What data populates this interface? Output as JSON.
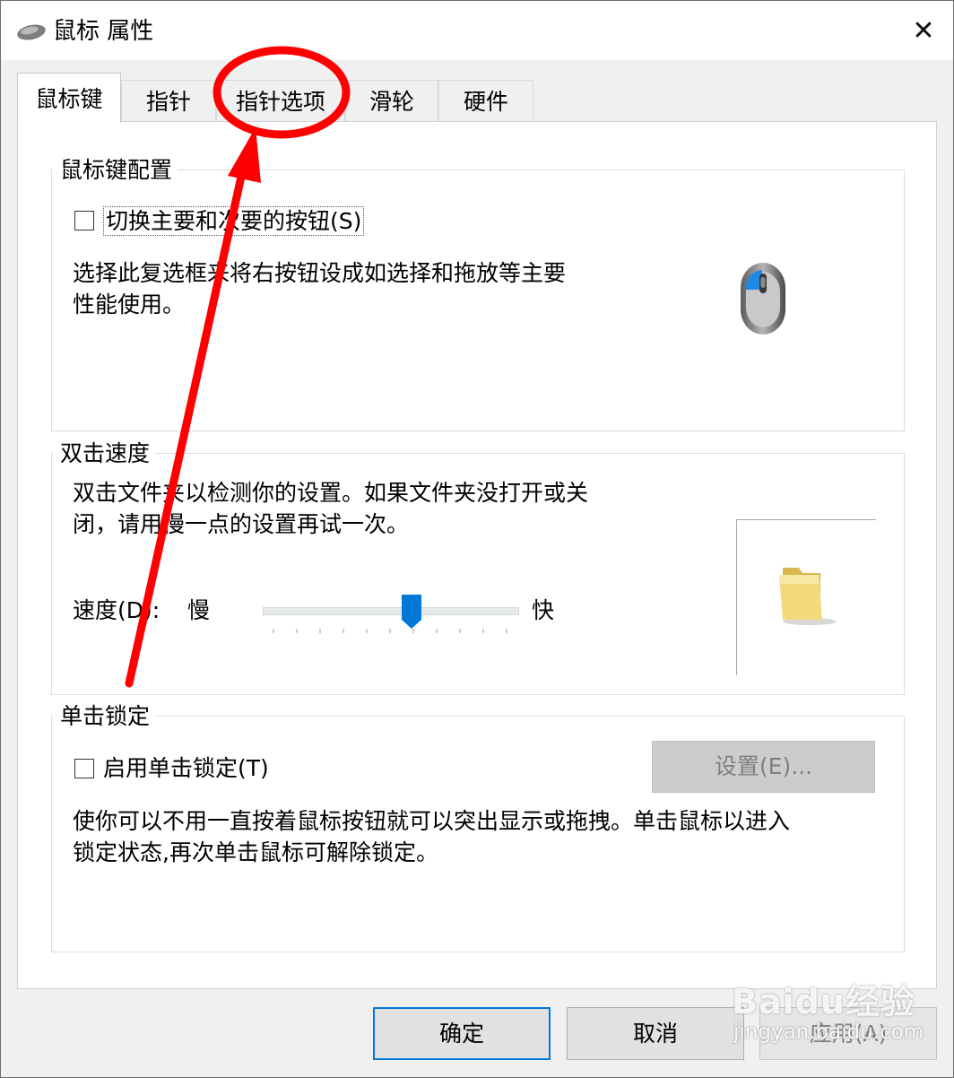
{
  "window": {
    "title": "鼠标 属性",
    "close_symbol": "✕"
  },
  "tabs": [
    {
      "label": "鼠标键",
      "active": true
    },
    {
      "label": "指针",
      "active": false
    },
    {
      "label": "指针选项",
      "active": false
    },
    {
      "label": "滑轮",
      "active": false
    },
    {
      "label": "硬件",
      "active": false
    }
  ],
  "button_config": {
    "group_title": "鼠标键配置",
    "switch_checkbox_label": "切换主要和次要的按钮(S)",
    "switch_checked": false,
    "description_line1": "选择此复选框来将右按钮设成如选择和拖放等主要",
    "description_line2": "性能使用。"
  },
  "double_click": {
    "group_title": "双击速度",
    "description_line1": "双击文件夹以检测你的设置。如果文件夹没打开或关",
    "description_line2": "闭，请用慢一点的设置再试一次。",
    "speed_label": "速度(D):",
    "slow_label": "慢",
    "fast_label": "快",
    "speed_level": 0.58
  },
  "click_lock": {
    "group_title": "单击锁定",
    "enable_checkbox_label": "启用单击锁定(T)",
    "enable_checked": false,
    "settings_button_label": "设置(E)...",
    "description_line1": "使你可以不用一直按着鼠标按钮就可以突出显示或拖拽。单击鼠标以进入",
    "description_line2": "锁定状态,再次单击鼠标可解除锁定。"
  },
  "footer": {
    "ok_label": "确定",
    "cancel_label": "取消",
    "apply_label": "应用(A)"
  },
  "watermark": {
    "brand": "Baidu经验",
    "site": "jingyan.baidu.com"
  },
  "colors": {
    "accent": "#0078d7",
    "annotation": "#ff0000",
    "disabled_button": "#cccccc"
  },
  "icons": [
    "mouse-icon",
    "close-icon",
    "mouse-illustration-icon",
    "folder-icon"
  ]
}
